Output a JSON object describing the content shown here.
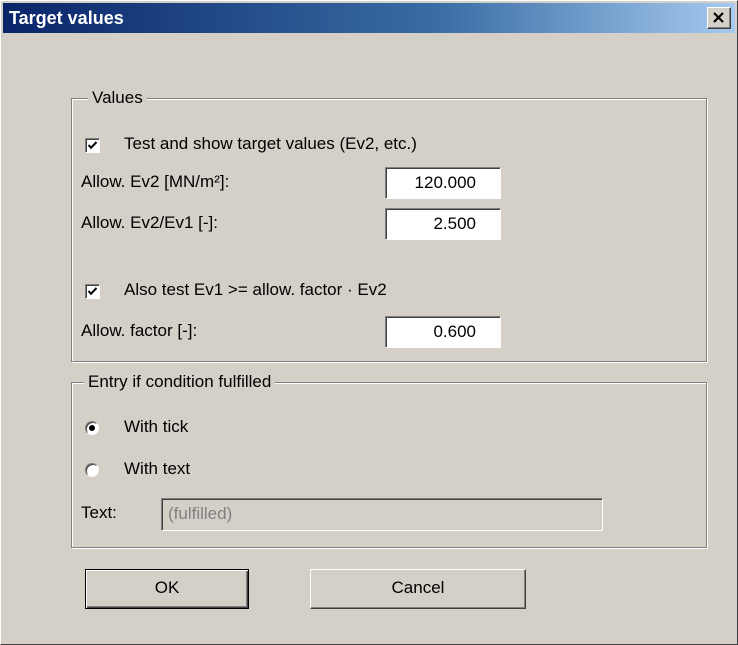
{
  "window": {
    "title": "Target values",
    "close_icon": "close-icon"
  },
  "values_group": {
    "title": "Values",
    "test_checkbox": {
      "label": "Test and show target values (Ev2, etc.)",
      "checked": true
    },
    "allow_ev2": {
      "label": "Allow. Ev2 [MN/m²]:",
      "value": "120.000"
    },
    "allow_ratio": {
      "label": "Allow. Ev2/Ev1 [-]:",
      "value": "2.500"
    },
    "also_test_checkbox": {
      "label": "Also test Ev1 >= allow. factor · Ev2",
      "checked": true
    },
    "allow_factor": {
      "label": "Allow. factor [-]:",
      "value": "0.600"
    }
  },
  "entry_group": {
    "title": "Entry if condition fulfilled",
    "radio_tick": {
      "label": "With tick",
      "selected": true
    },
    "radio_text": {
      "label": "With text",
      "selected": false
    },
    "text_field": {
      "label": "Text:",
      "value": "(fulfilled)",
      "disabled": true
    }
  },
  "buttons": {
    "ok_label": "OK",
    "cancel_label": "Cancel"
  }
}
